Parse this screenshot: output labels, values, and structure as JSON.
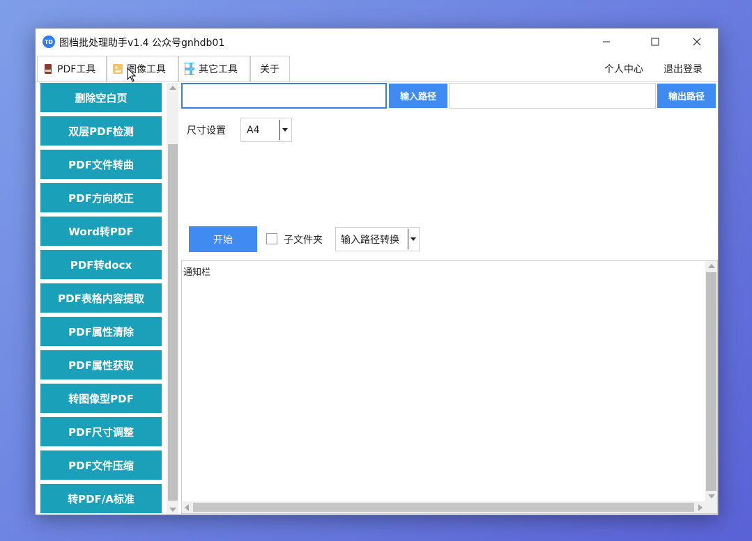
{
  "window": {
    "icon_text": "TD",
    "title": "图档批处理助手v1.4 公众号gnhdb01"
  },
  "tabs": [
    {
      "label": "PDF工具",
      "icon": "pdf-file-icon"
    },
    {
      "label": "图像工具",
      "icon": "image-icon"
    },
    {
      "label": "其它工具",
      "icon": "grid-icon"
    },
    {
      "label": "关于"
    }
  ],
  "header_links": {
    "user_center": "个人中心",
    "logout": "退出登录"
  },
  "sidebar": {
    "items": [
      {
        "label": "删除空白页"
      },
      {
        "label": "双层PDF检测"
      },
      {
        "label": "PDF文件转曲"
      },
      {
        "label": "PDF方向校正"
      },
      {
        "label": "Word转PDF"
      },
      {
        "label": "PDF转docx"
      },
      {
        "label": "PDF表格内容提取"
      },
      {
        "label": "PDF属性清除"
      },
      {
        "label": "PDF属性获取"
      },
      {
        "label": "转图像型PDF"
      },
      {
        "label": "PDF尺寸调整"
      },
      {
        "label": "PDF文件压缩"
      },
      {
        "label": "转PDF/A标准"
      }
    ]
  },
  "paths": {
    "input_value": "",
    "input_button": "输入路径",
    "output_value": "",
    "output_button": "输出路径"
  },
  "size_setting": {
    "label": "尺寸设置",
    "value": "A4"
  },
  "controls": {
    "start_button": "开始",
    "subfolder_label": "子文件夹",
    "subfolder_checked": false,
    "mode_value": "输入路径转换"
  },
  "notice": {
    "text": "通知栏"
  },
  "colors": {
    "sidebar_button": "#1aa0b8",
    "primary_button": "#3f8bf2",
    "focus_border": "#3b7fd6"
  }
}
